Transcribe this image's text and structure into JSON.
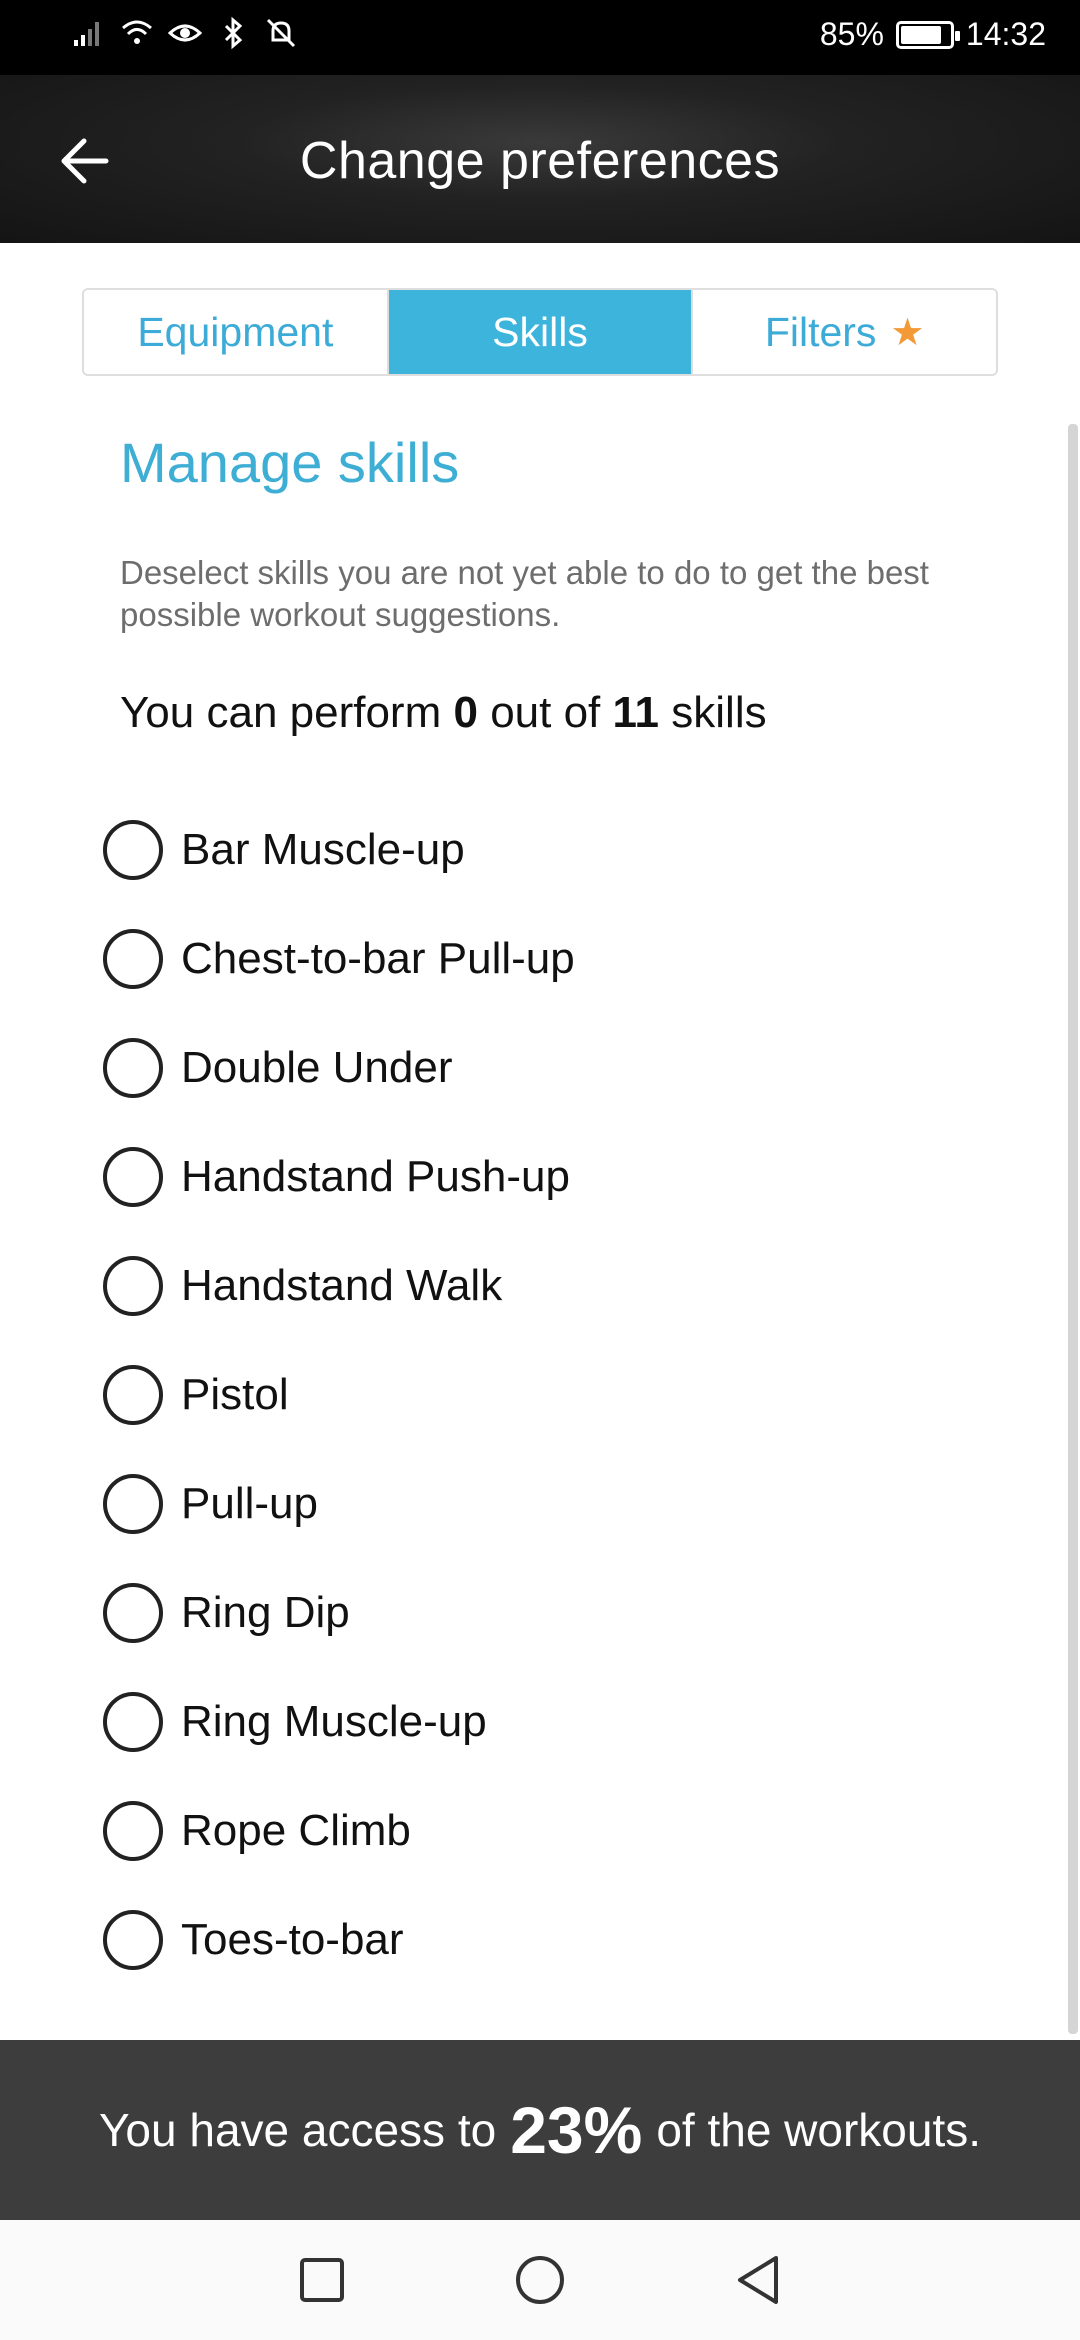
{
  "status_bar": {
    "battery_percent": "85%",
    "battery_level": 0.85,
    "time": "14:32",
    "icons": [
      "signal-icon",
      "wifi-icon",
      "eye-icon",
      "bluetooth-icon",
      "mute-notifications-icon"
    ]
  },
  "header": {
    "title": "Change preferences",
    "back_icon": "arrow-left-icon"
  },
  "tabs": [
    {
      "label": "Equipment",
      "active": false
    },
    {
      "label": "Skills",
      "active": true
    },
    {
      "label": "Filters",
      "active": false,
      "badge_icon": "star-icon"
    }
  ],
  "skills_section": {
    "title": "Manage skills",
    "description": "Deselect skills you are not yet able to do to get the best possible workout suggestions.",
    "summary": {
      "prefix": "You can perform",
      "count": "0",
      "middle": "out of",
      "total": "11",
      "suffix": "skills"
    },
    "items": [
      {
        "label": "Bar Muscle-up",
        "selected": false
      },
      {
        "label": "Chest-to-bar Pull-up",
        "selected": false
      },
      {
        "label": "Double Under",
        "selected": false
      },
      {
        "label": "Handstand Push-up",
        "selected": false
      },
      {
        "label": "Handstand Walk",
        "selected": false
      },
      {
        "label": "Pistol",
        "selected": false
      },
      {
        "label": "Pull-up",
        "selected": false
      },
      {
        "label": "Ring Dip",
        "selected": false
      },
      {
        "label": "Ring Muscle-up",
        "selected": false
      },
      {
        "label": "Rope Climb",
        "selected": false
      },
      {
        "label": "Toes-to-bar",
        "selected": false
      }
    ]
  },
  "footer": {
    "prefix": "You have access to",
    "percent": "23%",
    "suffix": "of the workouts."
  },
  "nav_bar": {
    "buttons": [
      "recents-icon",
      "home-icon",
      "back-icon"
    ]
  },
  "colors": {
    "accent": "#3db4dc",
    "star": "#f39a36",
    "footer_bg": "#3d3d3d"
  }
}
